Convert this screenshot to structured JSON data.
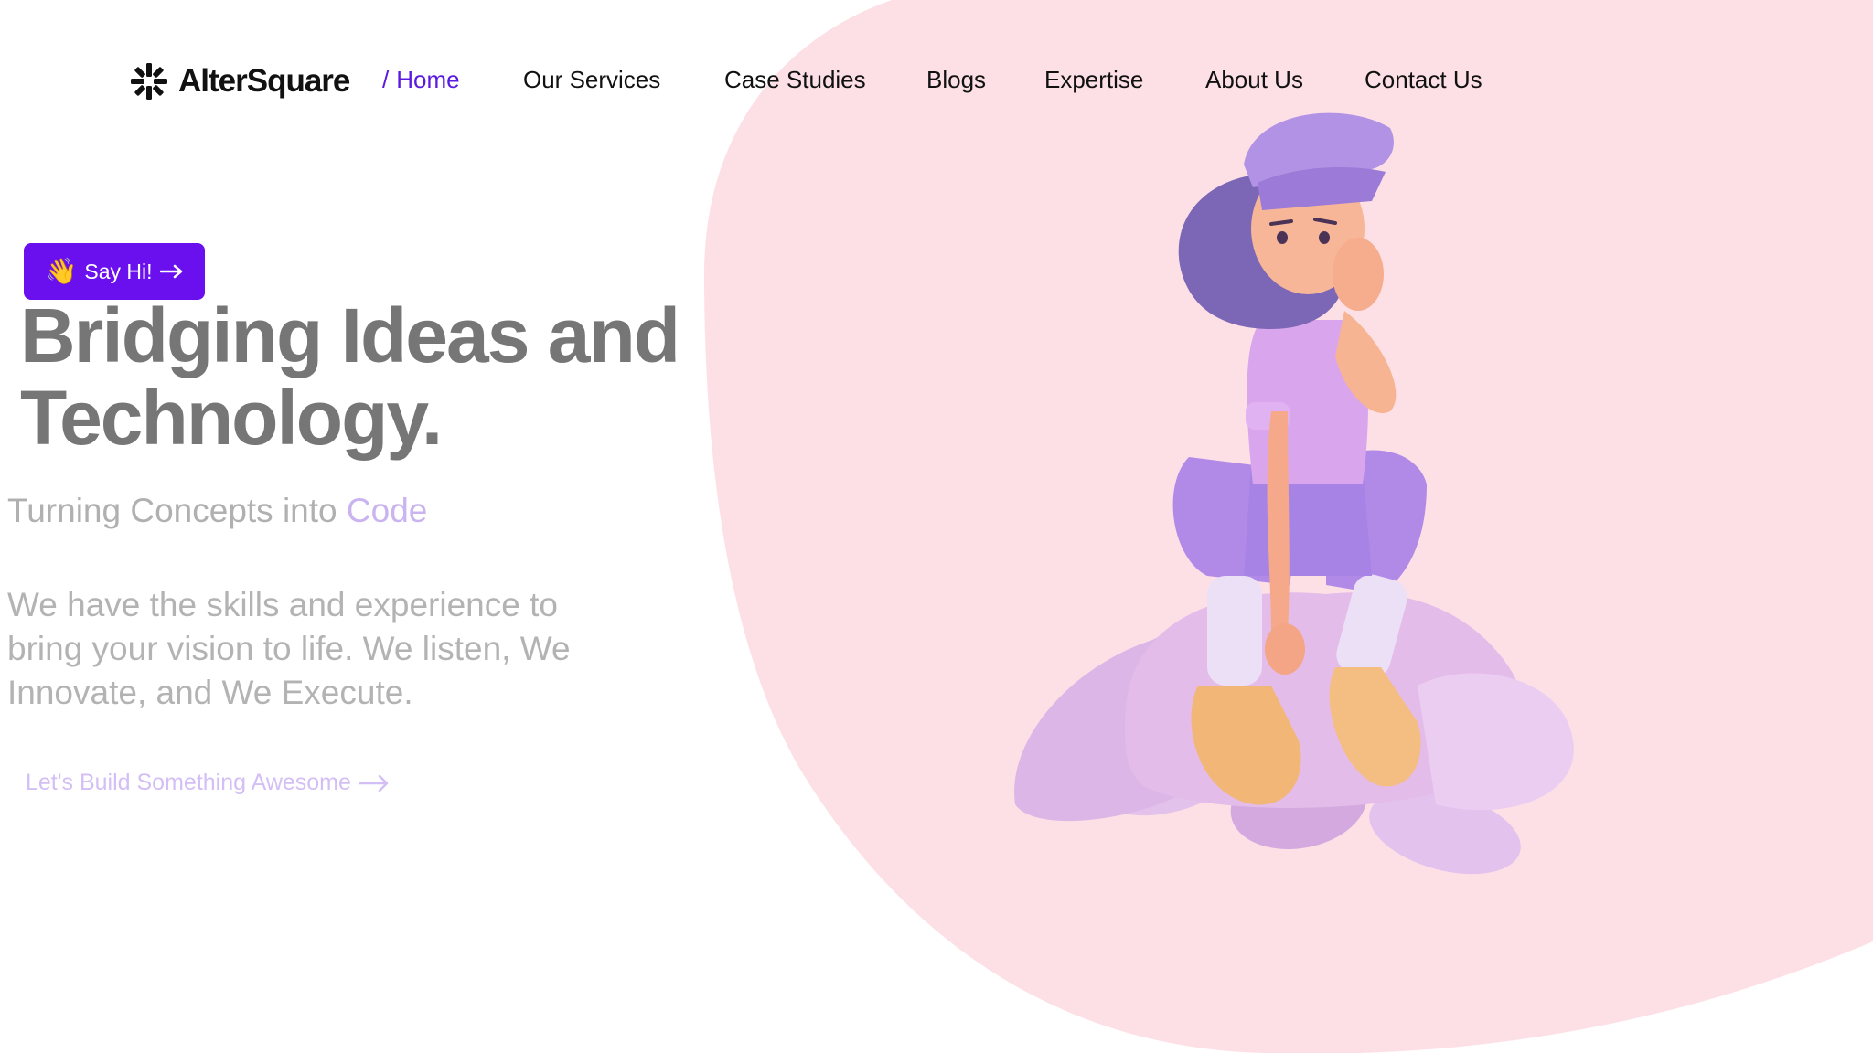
{
  "colors": {
    "accent": "#6a10ee",
    "nav_active": "#5a1ae0",
    "blob": "#fde0e6",
    "headline": "#767676",
    "code_accent": "#c9b4ef",
    "cta": "#d3bff5"
  },
  "brand": {
    "name": "AlterSquare",
    "logo_icon": "spark-burst-icon"
  },
  "nav": {
    "active_prefix": "/",
    "items": [
      {
        "label": "Home",
        "active": true
      },
      {
        "label": "Our Services"
      },
      {
        "label": "Case Studies"
      },
      {
        "label": "Blogs"
      },
      {
        "label": "Expertise"
      },
      {
        "label": "About Us"
      },
      {
        "label": "Contact Us"
      }
    ]
  },
  "hero": {
    "say_hi": {
      "emoji": "👋",
      "label": "Say Hi!",
      "icon": "arrow-right-icon"
    },
    "headline_line1": "Bridging Ideas and",
    "headline_line2": "Technology.",
    "subtitle_prefix": "Turning Concepts into",
    "subtitle_accent": "Code",
    "paragraph_line1": "We have the skills and experience to",
    "paragraph_line2": "bring your vision to life. We listen, We",
    "paragraph_line3": "Innovate, and We Execute.",
    "cta": {
      "label": "Let's Build Something Awesome",
      "icon": "arrow-right-icon"
    }
  },
  "illustration": {
    "icon": "girl-sitting-on-rocks-illustration"
  }
}
